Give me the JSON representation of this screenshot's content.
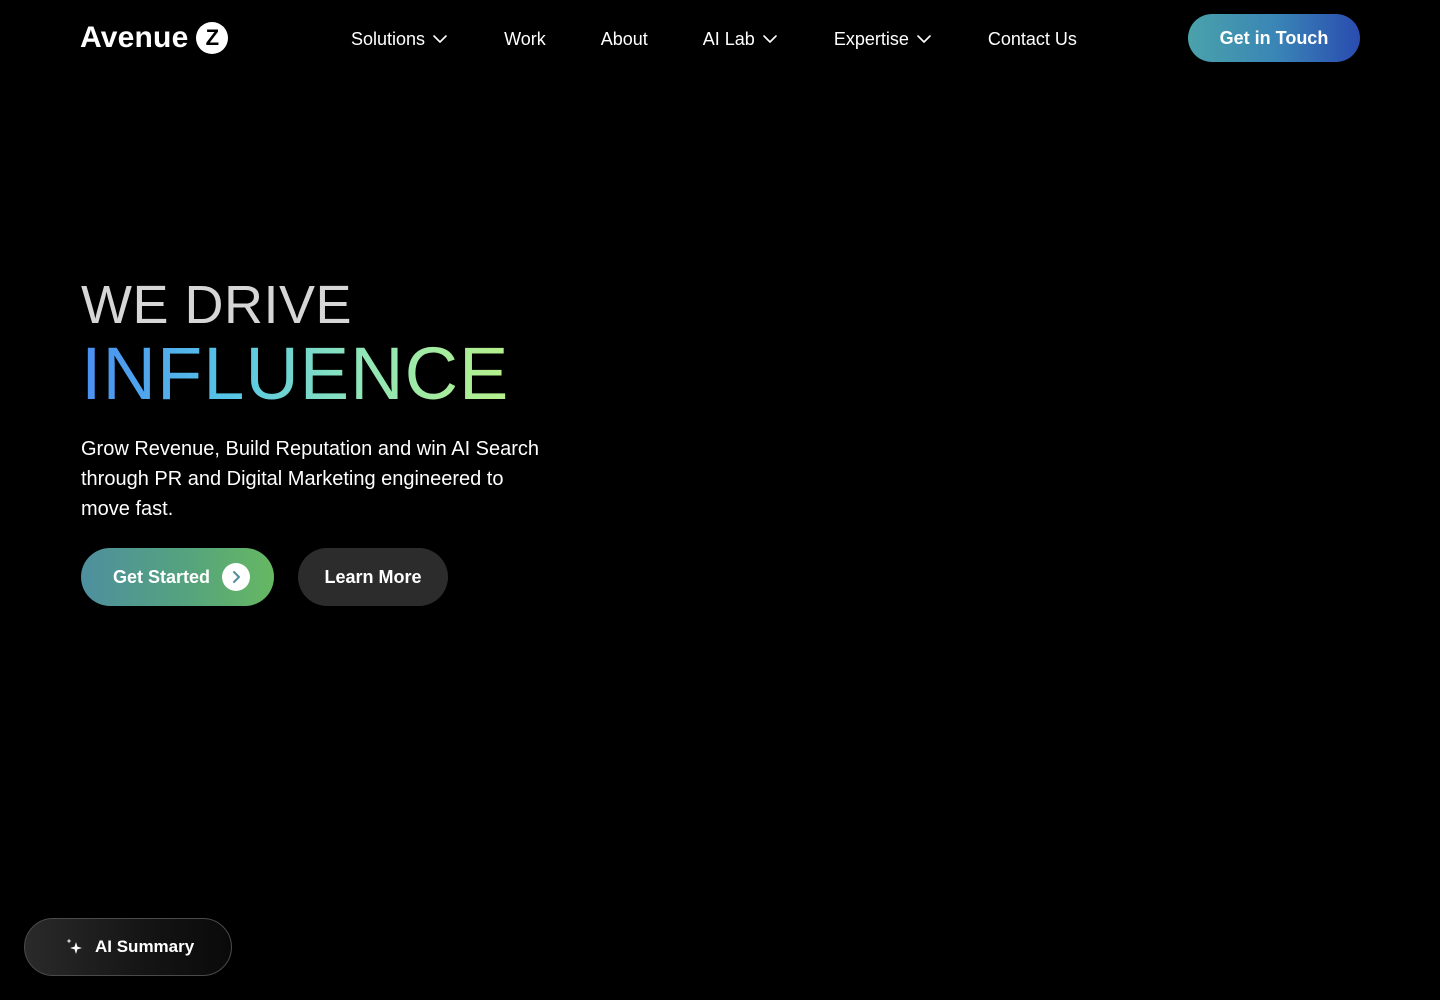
{
  "brand": {
    "name": "Avenue",
    "mark": "Z"
  },
  "nav": {
    "items": [
      {
        "label": "Solutions",
        "has_dropdown": true,
        "icon": "chevron-down-icon"
      },
      {
        "label": "Work",
        "has_dropdown": false
      },
      {
        "label": "About",
        "has_dropdown": false
      },
      {
        "label": "AI Lab",
        "has_dropdown": true,
        "icon": "chevron-down-icon"
      },
      {
        "label": "Expertise",
        "has_dropdown": true,
        "icon": "chevron-down-icon"
      },
      {
        "label": "Contact Us",
        "has_dropdown": false
      }
    ],
    "cta_label": "Get in Touch"
  },
  "hero": {
    "line1": "WE DRIVE",
    "line2": "INFLUENCE",
    "subtitle": "Grow Revenue, Build Reputation and win AI Search through PR and Digital Marketing engineered to move fast.",
    "primary_button": {
      "label": "Get Started",
      "icon": "arrow-right-icon"
    },
    "secondary_button": {
      "label": "Learn More"
    }
  },
  "ai_summary": {
    "label": "AI Summary",
    "icon": "sparkle-icon"
  },
  "colors": {
    "background": "#000000",
    "cta_gradient_start": "#4aa2aa",
    "cta_gradient_end": "#2a4cb0",
    "headline_gradient_start": "#4a8ef2",
    "headline_gradient_end": "#b6f08a",
    "started_gradient_start": "#4e8f9e",
    "started_gradient_end": "#66b862",
    "secondary_button": "#2c2c2c"
  }
}
